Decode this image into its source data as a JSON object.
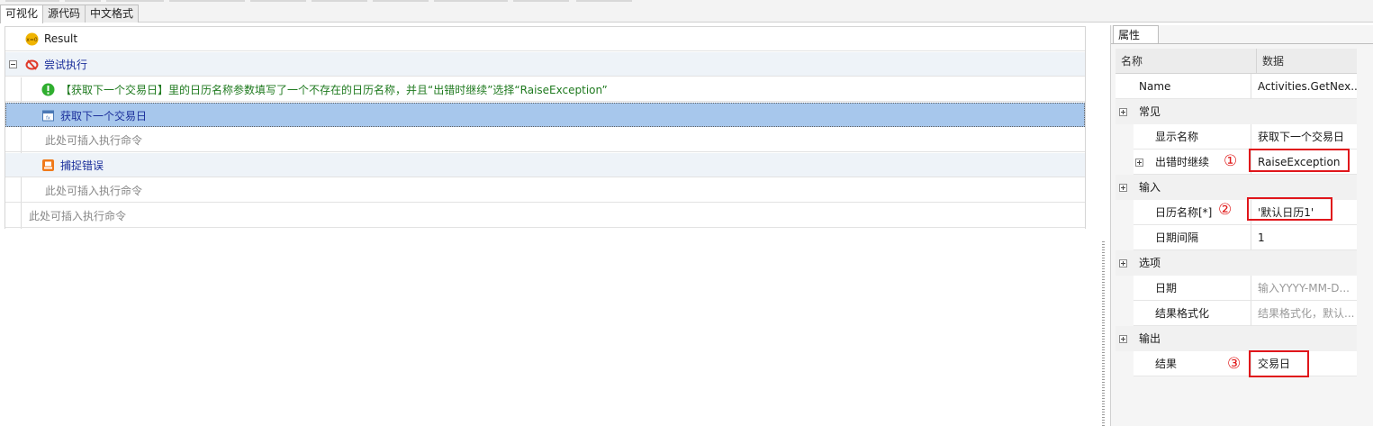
{
  "tabs": [
    {
      "label": "可视化",
      "active": true
    },
    {
      "label": "源代码",
      "active": false
    },
    {
      "label": "中文格式",
      "active": false
    }
  ],
  "editor": {
    "result_label": "Result",
    "try_block_label": "尝试执行",
    "warning_text": "【获取下一个交易日】里的日历名称参数填写了一个不存在的日历名称，并且“出错时继续”选择“RaiseException”",
    "selected_activity": "获取下一个交易日",
    "insert_placeholder": "此处可插入执行命令",
    "catch_label": "捕捉错误"
  },
  "properties": {
    "panel_tab": "属性",
    "col_name": "名称",
    "col_data": "数据",
    "name_row": {
      "key": "Name",
      "value": "Activities.GetNex..."
    },
    "general": {
      "category": "常见",
      "display_name": {
        "key": "显示名称",
        "value": "获取下一个交易日"
      },
      "continue_on_error": {
        "key": "出错时继续",
        "value": "RaiseException"
      }
    },
    "input": {
      "category": "输入",
      "calendar_name": {
        "key": "日历名称[*]",
        "value": "'默认日历1'"
      },
      "date_interval": {
        "key": "日期间隔",
        "value": "1"
      }
    },
    "options": {
      "category": "选项",
      "date": {
        "key": "日期",
        "value": "输入YYYY-MM-D..."
      },
      "result_format": {
        "key": "结果格式化",
        "value": "结果格式化，默认..."
      }
    },
    "output": {
      "category": "输出",
      "result": {
        "key": "结果",
        "value": "交易日"
      }
    }
  },
  "annotations": {
    "n1": "①",
    "n2": "②",
    "n3": "③"
  },
  "colors": {
    "selection": "#a7c7ec",
    "annotation_red": "#e0161b",
    "warning_green": "#1f7a1f"
  }
}
